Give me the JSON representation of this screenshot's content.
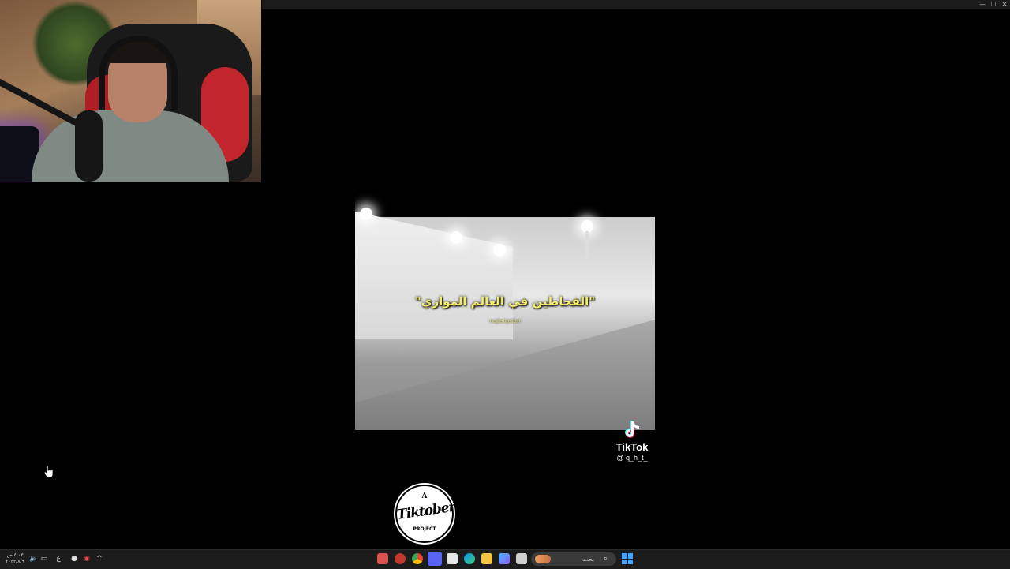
{
  "video": {
    "caption": "\"القحاطين في العالم الموازي\"",
    "credit": "najlehjetan"
  },
  "watermark": {
    "brand": "TikTok",
    "handle": "@ q_h_t_"
  },
  "logo": {
    "top": "A",
    "main": "Tiktober",
    "bottom": "PROJECT"
  },
  "taskbar": {
    "clock_time": "٤:٠٣ ص",
    "clock_date": "٢٠٢٣/٨/٩",
    "search_placeholder": "بحث",
    "tray_language": "ع",
    "icons": [
      "notification-icon",
      "volume-icon",
      "network-icon",
      "language-indicator",
      "microphone-icon",
      "app-tray-icon",
      "chevron-up-icon"
    ],
    "pinned_apps": [
      "mail-app",
      "red-app",
      "chrome",
      "discord",
      "store",
      "edge",
      "file-explorer",
      "gallery",
      "notepad"
    ]
  },
  "colors": {
    "caption": "#f4ee6a",
    "taskbar": "#1c1c1c",
    "windows_blue": "#3fa3ff"
  }
}
